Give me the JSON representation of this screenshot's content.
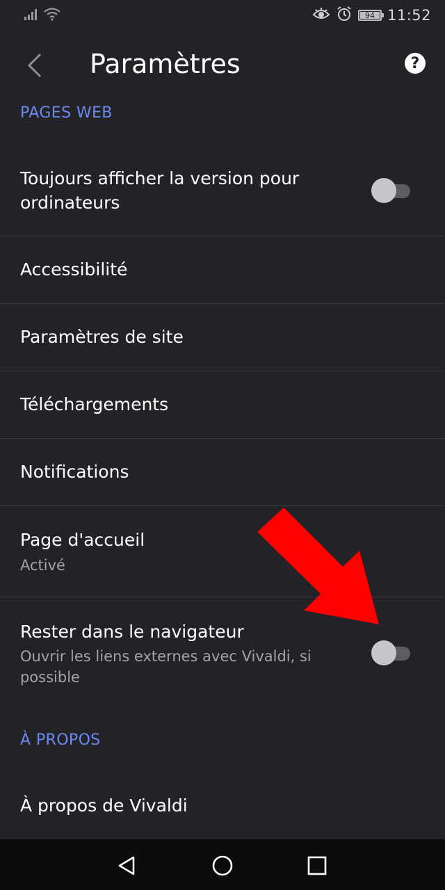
{
  "status_bar": {
    "time": "11:52",
    "battery": "94"
  },
  "app_bar": {
    "title": "Paramètres"
  },
  "sections": {
    "web_pages": "PAGES WEB",
    "about": "À PROPOS"
  },
  "settings": {
    "desktop_version": {
      "label_line1": "Toujours afficher la version pour",
      "label_line2": "ordinateurs",
      "enabled": false
    },
    "accessibility": {
      "label": "Accessibilité"
    },
    "site_settings": {
      "label": "Paramètres de site"
    },
    "downloads": {
      "label": "Téléchargements"
    },
    "notifications": {
      "label": "Notifications"
    },
    "homepage": {
      "label": "Page d'accueil",
      "value": "Activé"
    },
    "stay_in_browser": {
      "label": "Rester dans le navigateur",
      "sub_line1": "Ouvrir les liens externes avec Vivaldi, si",
      "sub_line2": "possible",
      "enabled": false
    },
    "about_vivaldi": {
      "label": "À propos de Vivaldi"
    }
  },
  "icons": {
    "back": "chevron-left-icon",
    "help": "help-icon",
    "nav_back": "triangle-back-icon",
    "nav_home": "circle-home-icon",
    "nav_recents": "square-recents-icon"
  },
  "colors": {
    "background": "#232327",
    "accent": "#6a8af0",
    "annotation_arrow": "#ff0000"
  }
}
